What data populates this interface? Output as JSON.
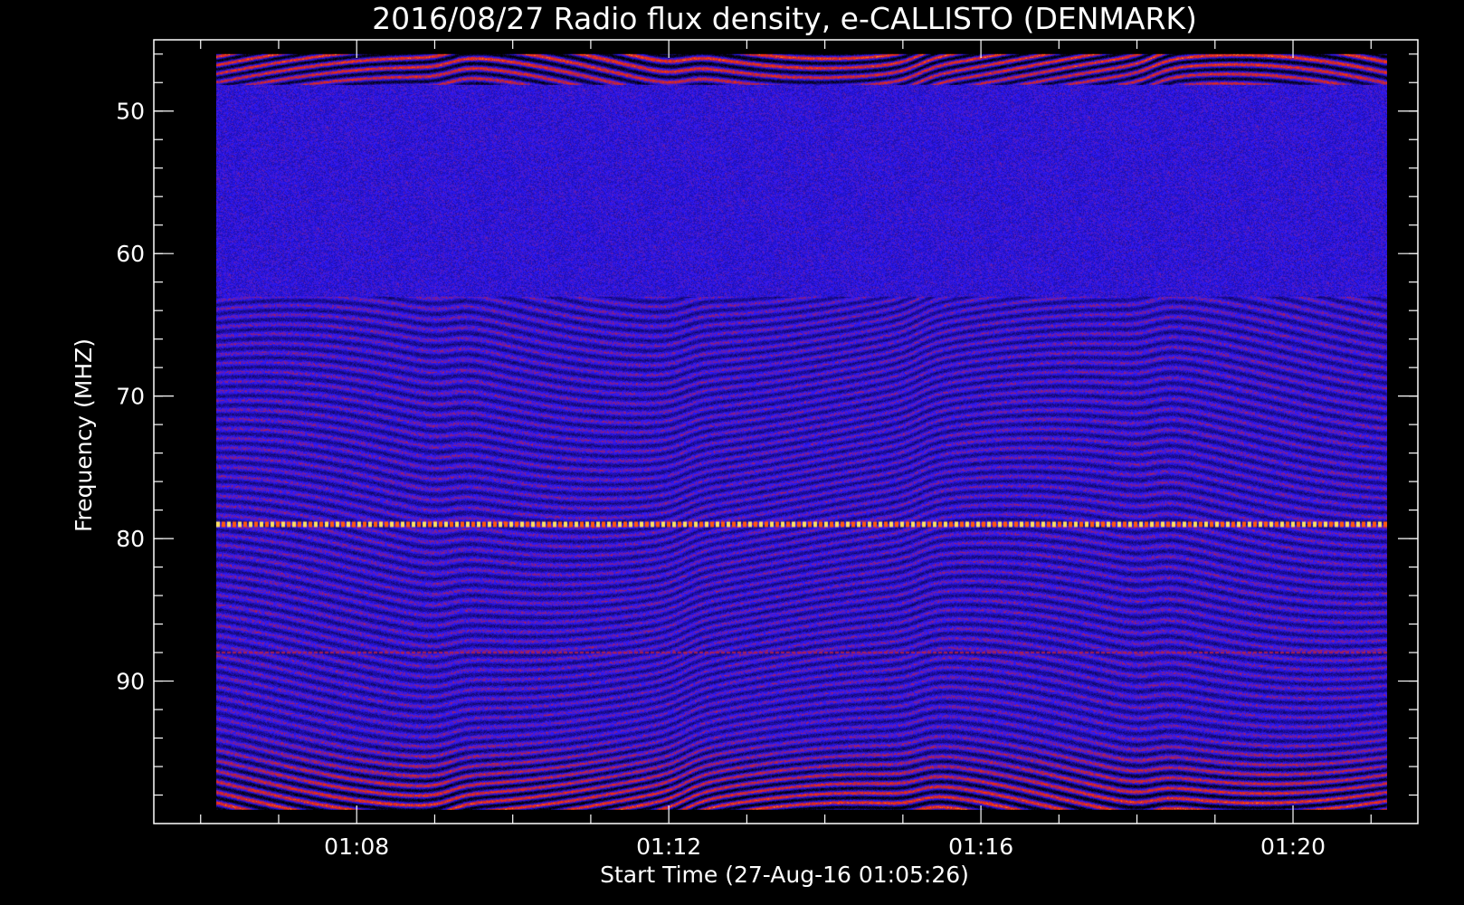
{
  "chart_data": {
    "type": "heatmap",
    "title": "2016/08/27  Radio flux density, e-CALLISTO (DENMARK)",
    "xlabel": "Start Time (27-Aug-16 01:05:26)",
    "ylabel": "Frequency (MHZ)",
    "x_start": "01:05:26",
    "x_ticks": [
      "01:08",
      "01:12",
      "01:16",
      "01:20"
    ],
    "x_tick_minutes": [
      8,
      12,
      16,
      20
    ],
    "xlim_minutes": [
      5.4,
      21.6
    ],
    "data_x_range_minutes": [
      6.2,
      21.2
    ],
    "y_ticks": [
      50,
      60,
      70,
      80,
      90
    ],
    "ylim": [
      45,
      100
    ],
    "y_inverted": true,
    "data_y_range": [
      46,
      99
    ],
    "colormap": [
      "#000000",
      "#1b0b8c",
      "#2a19ff",
      "#b0204a",
      "#ff3300",
      "#ffe060"
    ],
    "features": [
      {
        "label": "persistent interference line",
        "frequency": 79
      },
      {
        "label": "interference line",
        "frequency": 88
      }
    ]
  }
}
